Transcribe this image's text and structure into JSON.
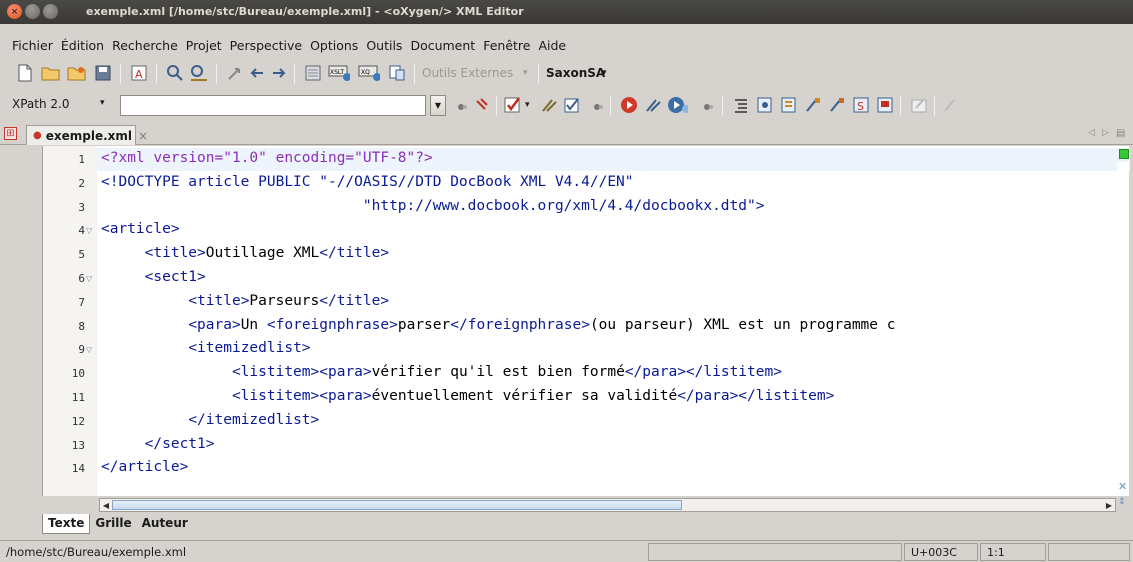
{
  "window": {
    "title": "exemple.xml [/home/stc/Bureau/exemple.xml] - <oXygen/> XML Editor"
  },
  "menu": [
    "Fichier",
    "Édition",
    "Recherche",
    "Projet",
    "Perspective",
    "Options",
    "Outils",
    "Document",
    "Fenêtre",
    "Aide"
  ],
  "toolbar": {
    "outils_externes": "Outils Externes",
    "saxon": "SaxonSA",
    "xpath_version": "XPath 2.0",
    "xpath_value": ""
  },
  "tab": {
    "label": "exemple.xml",
    "close": "×"
  },
  "editor": {
    "lines": [
      {
        "n": "1",
        "segments": [
          {
            "c": "pi",
            "t": "<?xml version=\"1.0\" encoding=\"UTF-8\"?>"
          }
        ]
      },
      {
        "n": "2",
        "segments": [
          {
            "c": "tag",
            "t": "<!DOCTYPE article PUBLIC \"-//OASIS//DTD DocBook XML V4.4//EN\""
          }
        ]
      },
      {
        "n": "3",
        "segments": [
          {
            "c": "str",
            "t": "                              \"http://www.docbook.org/xml/4.4/docbookx.dtd\">"
          }
        ]
      },
      {
        "n": "4",
        "fold": true,
        "segments": [
          {
            "c": "tag",
            "t": "<article>"
          }
        ]
      },
      {
        "n": "5",
        "segments": [
          {
            "c": "txt",
            "t": "     "
          },
          {
            "c": "tag",
            "t": "<title>"
          },
          {
            "c": "txt",
            "t": "Outillage XML"
          },
          {
            "c": "tag",
            "t": "</title>"
          }
        ]
      },
      {
        "n": "6",
        "fold": true,
        "segments": [
          {
            "c": "txt",
            "t": "     "
          },
          {
            "c": "tag",
            "t": "<sect1>"
          }
        ]
      },
      {
        "n": "7",
        "segments": [
          {
            "c": "txt",
            "t": "          "
          },
          {
            "c": "tag",
            "t": "<title>"
          },
          {
            "c": "txt",
            "t": "Parseurs"
          },
          {
            "c": "tag",
            "t": "</title>"
          }
        ]
      },
      {
        "n": "8",
        "segments": [
          {
            "c": "txt",
            "t": "          "
          },
          {
            "c": "tag",
            "t": "<para>"
          },
          {
            "c": "txt",
            "t": "Un "
          },
          {
            "c": "tag",
            "t": "<foreignphrase>"
          },
          {
            "c": "txt",
            "t": "parser"
          },
          {
            "c": "tag",
            "t": "</foreignphrase>"
          },
          {
            "c": "txt",
            "t": "(ou parseur) XML est un programme c"
          }
        ]
      },
      {
        "n": "9",
        "fold": true,
        "segments": [
          {
            "c": "txt",
            "t": "          "
          },
          {
            "c": "tag",
            "t": "<itemizedlist>"
          }
        ]
      },
      {
        "n": "10",
        "segments": [
          {
            "c": "txt",
            "t": "               "
          },
          {
            "c": "tag",
            "t": "<listitem><para>"
          },
          {
            "c": "txt",
            "t": "vérifier qu'il est bien formé"
          },
          {
            "c": "tag",
            "t": "</para></listitem>"
          }
        ]
      },
      {
        "n": "11",
        "segments": [
          {
            "c": "txt",
            "t": "               "
          },
          {
            "c": "tag",
            "t": "<listitem><para>"
          },
          {
            "c": "txt",
            "t": "éventuellement vérifier sa validité"
          },
          {
            "c": "tag",
            "t": "</para></listitem>"
          }
        ]
      },
      {
        "n": "12",
        "segments": [
          {
            "c": "txt",
            "t": "          "
          },
          {
            "c": "tag",
            "t": "</itemizedlist>"
          }
        ]
      },
      {
        "n": "13",
        "segments": [
          {
            "c": "txt",
            "t": "     "
          },
          {
            "c": "tag",
            "t": "</sect1>"
          }
        ]
      },
      {
        "n": "14",
        "segments": [
          {
            "c": "tag",
            "t": "</article>"
          }
        ]
      }
    ]
  },
  "mode_tabs": [
    "Texte",
    "Grille",
    "Auteur"
  ],
  "status": {
    "path": "/home/stc/Bureau/exemple.xml",
    "unicode": "U+003C",
    "position": "1:1"
  }
}
